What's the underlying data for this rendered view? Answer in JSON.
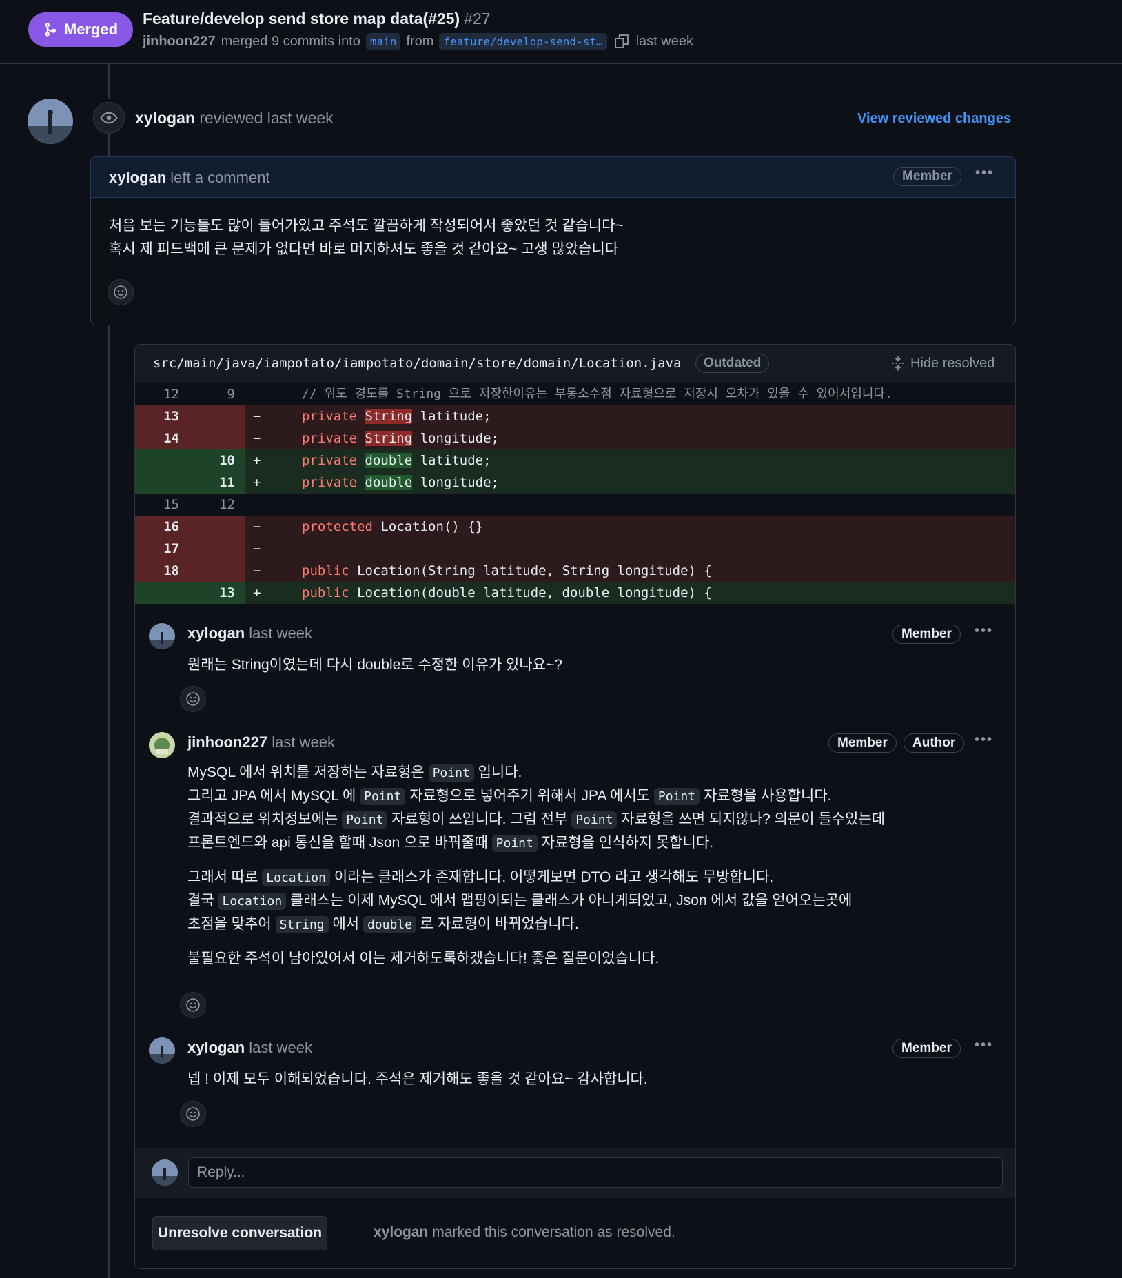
{
  "header": {
    "status": "Merged",
    "title": "Feature/develop send store map data(#25)",
    "number": "#27",
    "author": "jinhoon227",
    "merged_text": "merged 9 commits into",
    "base_branch": "main",
    "from_text": "from",
    "head_branch": "feature/develop-send-st…",
    "time": "last week"
  },
  "review": {
    "user": "xylogan",
    "action": "reviewed",
    "time": "last week",
    "view_changes": "View reviewed changes",
    "comment_user": "xylogan",
    "comment_action": "left a comment",
    "badge": "Member",
    "body_line1": "처음 보는 기능들도 많이 들어가있고 주석도 깔끔하게 작성되어서 좋았던 것 같습니다~",
    "body_line2": "혹시 제 피드백에 큰 문제가 없다면 바로 머지하셔도 좋을 것 같아요~ 고생 많았습니다"
  },
  "thread": {
    "file_path": "src/main/java/iampotato/iampotato/domain/store/domain/Location.java",
    "outdated": "Outdated",
    "hide_resolved": "Hide resolved",
    "diff": [
      {
        "type": "ctx",
        "old": "12",
        "new": "9",
        "sign": "",
        "code": "// 위도 경도를 String 으로 저장한이유는 부동소수점 자료형으로 저장시 오차가 있을 수 있어서입니다."
      },
      {
        "type": "del",
        "old": "13",
        "new": "",
        "sign": "−",
        "pre": "private ",
        "hl": "String",
        "post": " latitude;"
      },
      {
        "type": "del",
        "old": "14",
        "new": "",
        "sign": "−",
        "pre": "private ",
        "hl": "String",
        "post": " longitude;"
      },
      {
        "type": "add",
        "old": "",
        "new": "10",
        "sign": "+",
        "pre": "private ",
        "hl": "double",
        "post": " latitude;"
      },
      {
        "type": "add",
        "old": "",
        "new": "11",
        "sign": "+",
        "pre": "private ",
        "hl": "double",
        "post": " longitude;"
      },
      {
        "type": "ctx",
        "old": "15",
        "new": "12",
        "sign": "",
        "code": ""
      },
      {
        "type": "del",
        "old": "16",
        "new": "",
        "sign": "−",
        "pre": "protected ",
        "hl": "",
        "post": "Location() {}"
      },
      {
        "type": "del",
        "old": "17",
        "new": "",
        "sign": "−",
        "pre": "",
        "hl": "",
        "post": ""
      },
      {
        "type": "del",
        "old": "18",
        "new": "",
        "sign": "−",
        "pre": "public ",
        "hl": "",
        "post": "Location(String latitude, String longitude) {"
      },
      {
        "type": "add",
        "old": "",
        "new": "13",
        "sign": "+",
        "pre": "public ",
        "hl": "",
        "post": "Location(double latitude, double longitude) {"
      }
    ],
    "comments": [
      {
        "user": "xylogan",
        "time": "last week",
        "badges": [
          "Member"
        ],
        "body": "원래는 String이였는데 다시 double로 수정한 이유가 있나요~?"
      },
      {
        "user": "jinhoon227",
        "time": "last week",
        "badges": [
          "Member",
          "Author"
        ],
        "lines": [
          [
            "MySQL 에서 위치를 저장하는 자료형은 ",
            "Point",
            " 입니다."
          ],
          [
            "그리고 JPA 에서 MySQL 에 ",
            "Point",
            " 자료형으로 넣어주기 위해서 JPA 에서도 ",
            "Point",
            " 자료형을 사용합니다."
          ],
          [
            "결과적으로 위치정보에는 ",
            "Point",
            " 자료형이 쓰입니다. 그럼 전부 ",
            "Point",
            " 자료형을 쓰면 되지않나? 의문이 들수있는데"
          ],
          [
            "프론트엔드와 api 통신을 할때 Json 으로 바꿔줄때 ",
            "Point",
            " 자료형을 인식하지 못합니다."
          ],
          [
            "그래서 따로 ",
            "Location",
            " 이라는 클래스가 존재합니다. 어떻게보면 DTO 라고 생각해도 무방합니다."
          ],
          [
            "결국 ",
            "Location",
            " 클래스는 이제 MySQL 에서 맵핑이되는 클래스가 아니게되었고, Json 에서 값을 얻어오는곳에"
          ],
          [
            "초점을 맞추어 ",
            "String",
            " 에서 ",
            "double",
            " 로 자료형이 바뀌었습니다."
          ],
          [
            "불필요한 주석이 남아있어서 이는 제거하도록하겠습니다! 좋은 질문이었습니다."
          ]
        ]
      },
      {
        "user": "xylogan",
        "time": "last week",
        "badges": [
          "Member"
        ],
        "body": "넵 ! 이제 모두 이해되었습니다. 주석은 제거해도 좋을 것 같아요~ 감사합니다."
      }
    ],
    "reply_placeholder": "Reply...",
    "unresolve_label": "Unresolve conversation",
    "resolved_user": "xylogan",
    "resolved_text": "marked this conversation as resolved."
  },
  "colors": {
    "merged": "#8957e5",
    "link": "#4493f8",
    "bg": "#0d1117"
  }
}
